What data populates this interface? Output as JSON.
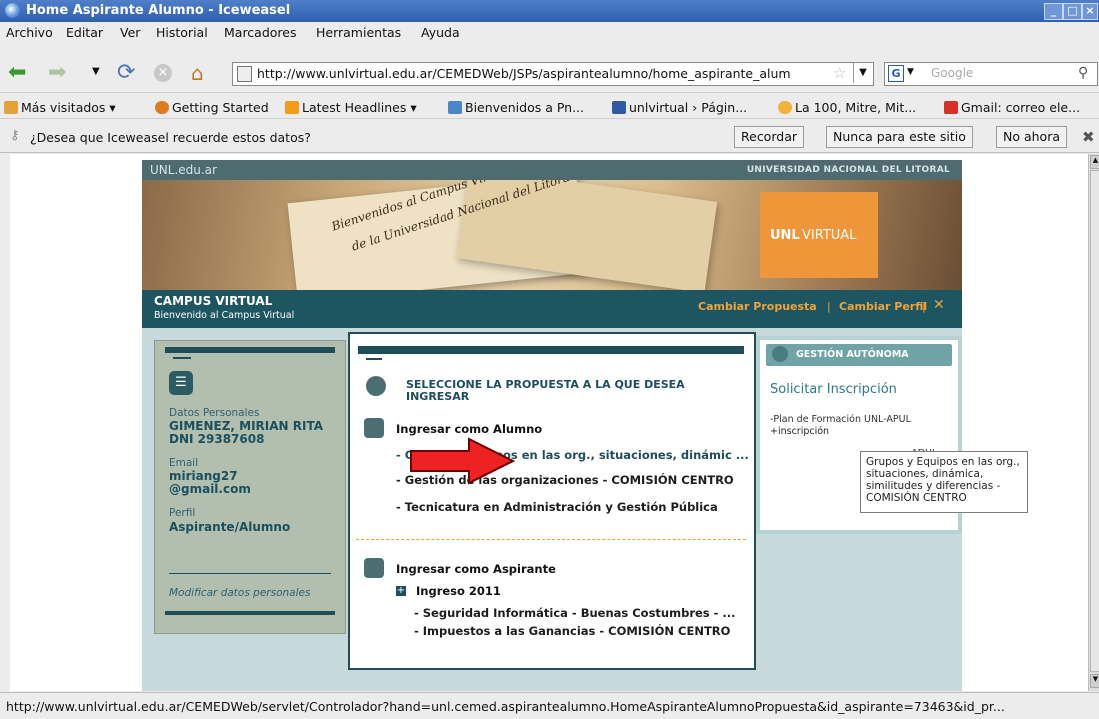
{
  "window": {
    "title": "Home Aspirante Alumno - Iceweasel"
  },
  "menu": [
    "Archivo",
    "Editar",
    "Ver",
    "Historial",
    "Marcadores",
    "Herramientas",
    "Ayuda"
  ],
  "nav": {
    "url": "http://www.unlvirtual.edu.ar/CEMEDWeb/JSPs/aspirantealumno/home_aspirante_alum",
    "search_placeholder": "Google"
  },
  "bookmarks": [
    {
      "label": "Más visitados ▾",
      "color": "#e4a23b"
    },
    {
      "label": "Getting Started",
      "color": "#e07a1f"
    },
    {
      "label": "Latest Headlines ▾",
      "color": "#f29c18"
    },
    {
      "label": "Bienvenidos a Pn...",
      "color": "#4a86c8"
    },
    {
      "label": "unlvirtual › Págin...",
      "color": "#2d5aa0"
    },
    {
      "label": "La 100, Mitre, Mit...",
      "color": "#f2b23a"
    },
    {
      "label": "Gmail: correo ele...",
      "color": "#d93025"
    }
  ],
  "notification": {
    "text": "¿Desea que Iceweasel recuerde estos datos?",
    "remember": "Recordar",
    "never": "Nunca para este sitio",
    "not_now": "No ahora"
  },
  "site": {
    "top_left": "UNL.edu.ar",
    "top_right": "UNIVERSIDAD NACIONAL DEL LITORAL",
    "banner_script_1": "Bienvenidos al Campus Virtual",
    "banner_script_2": "de la Universidad Nacional del Litoral",
    "logo_bold": "UNL",
    "logo_rest": "VIRTUAL",
    "cv_title": "CAMPUS VIRTUAL",
    "cv_subtitle": "Bienvenido al Campus Virtual",
    "cambiar_propuesta": "Cambiar Propuesta",
    "sep": "|",
    "cambiar_perfil": "Cambiar Perfil"
  },
  "profile": {
    "datos_label": "Datos Personales",
    "name": "GIMENEZ, MIRIAN RITA",
    "dni": "DNI 29387608",
    "email_label": "Email",
    "email_1": "miriang27",
    "email_2": "@gmail.com",
    "perfil_label": "Perfil",
    "perfil": "Aspirante/Alumno",
    "modificar": "Modificar datos personales"
  },
  "center": {
    "title_1": "SELECCIONE LA PROPUESTA A LA QUE DESEA",
    "title_2": "INGRESAR",
    "alumno_heading": "Ingresar como Alumno",
    "alumno_items": [
      "- Grupos y Equipos en las org., situaciones, dinámic ...",
      "- Gestión de las organizaciones - COMISIÓN CENTRO",
      "- Tecnicatura en Administración y Gestión Pública"
    ],
    "aspirante_heading": "Ingresar como Aspirante",
    "ingreso": "Ingreso 2011",
    "aspirante_items": [
      "- Seguridad Informática - Buenas Costumbres - ...",
      "- Impuestos a las Ganancias - COMISIÓN CENTRO"
    ]
  },
  "right": {
    "header": "GESTIÓN AUTÓNOMA",
    "solicitar": "Solicitar Inscripción",
    "plan": "-Plan de Formación UNL-APUL",
    "inscripcion": "+inscripción",
    "adul_fragment": "-ADUL"
  },
  "tooltip": {
    "line1": "Grupos y Equipos en las org.,",
    "line2": "situaciones, dinámica,",
    "line3": "similitudes y diferencias -",
    "line4": "COMISIÓN CENTRO"
  },
  "status": "http://www.unlvirtual.edu.ar/CEMEDWeb/servlet/Controlador?hand=unl.cemed.aspirantealumno.HomeAspiranteAlumnoPropuesta&id_aspirante=73463&id_pr..."
}
